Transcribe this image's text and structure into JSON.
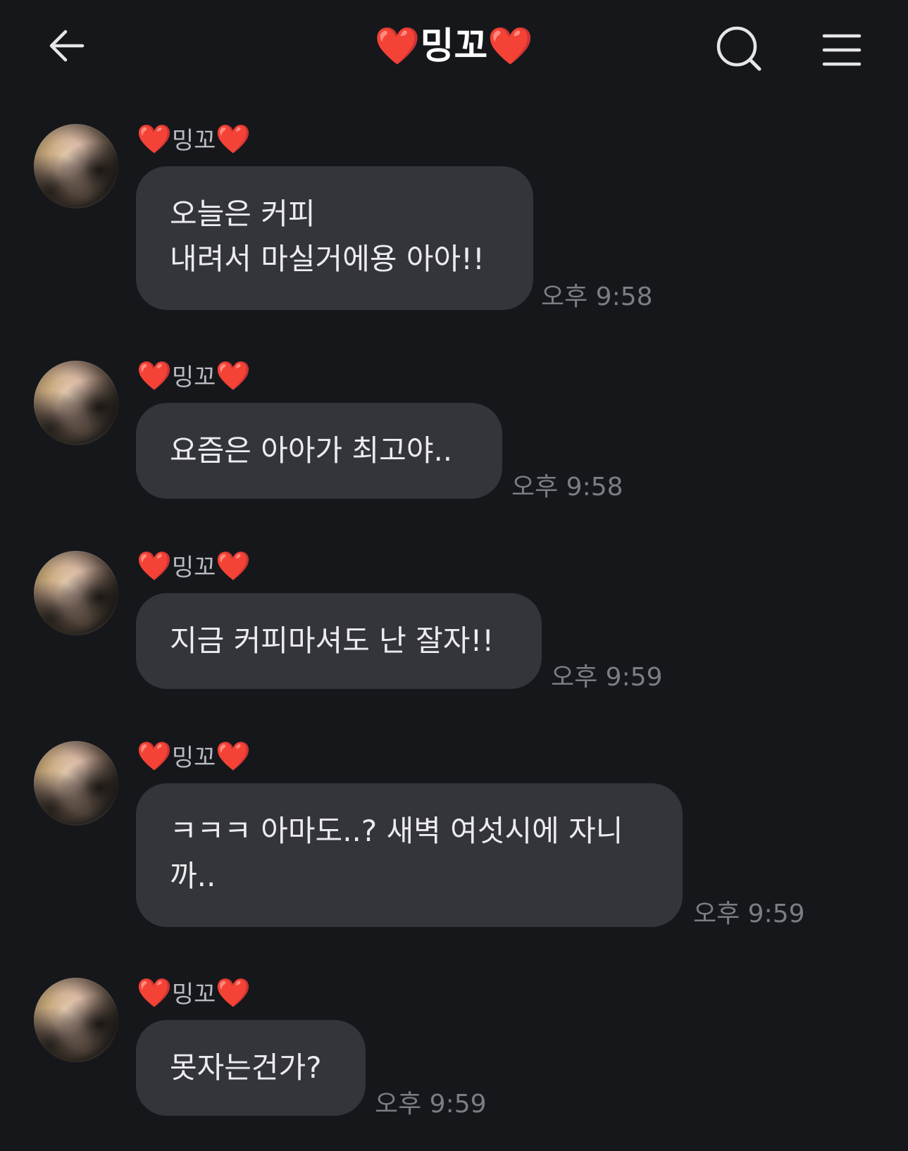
{
  "header": {
    "title_heart_left": "❤️",
    "title_name": "밍꼬",
    "title_heart_right": "❤️",
    "back_icon": "arrow-left-icon",
    "search_icon": "search-icon",
    "menu_icon": "hamburger-menu-icon"
  },
  "colors": {
    "background": "#16171b",
    "bubble": "#34353b",
    "heart": "#e8262b",
    "time_text": "#7c7d84"
  },
  "messages": [
    {
      "sender_heart_left": "❤️",
      "sender_name": "밍꼬",
      "sender_heart_right": "❤️",
      "lines": [
        "오늘은 커피",
        "내려서 마실거에용 아아!!"
      ],
      "time": "오후 9:58"
    },
    {
      "sender_heart_left": "❤️",
      "sender_name": "밍꼬",
      "sender_heart_right": "❤️",
      "lines": [
        "요즘은 아아가 최고야.."
      ],
      "time": "오후 9:58"
    },
    {
      "sender_heart_left": "❤️",
      "sender_name": "밍꼬",
      "sender_heart_right": "❤️",
      "lines": [
        "지금 커피마셔도 난 잘자!!"
      ],
      "time": "오후 9:59"
    },
    {
      "sender_heart_left": "❤️",
      "sender_name": "밍꼬",
      "sender_heart_right": "❤️",
      "lines": [
        "ㅋㅋㅋ 아마도..? 새벽 여섯시에 자니",
        "까.."
      ],
      "time": "오후 9:59"
    },
    {
      "sender_heart_left": "❤️",
      "sender_name": "밍꼬",
      "sender_heart_right": "❤️",
      "lines": [
        "못자는건가?"
      ],
      "time": "오후 9:59"
    }
  ]
}
